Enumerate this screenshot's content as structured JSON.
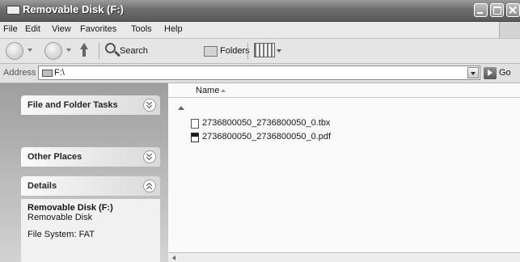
{
  "window": {
    "title": "Removable Disk (F:)"
  },
  "menu": {
    "items": [
      {
        "label": "File"
      },
      {
        "label": "Edit"
      },
      {
        "label": "View"
      },
      {
        "label": "Favorites"
      },
      {
        "label": "Tools"
      },
      {
        "label": "Help"
      }
    ]
  },
  "toolbar": {
    "search_label": "Search",
    "folders_label": "Folders"
  },
  "address": {
    "label": "Address",
    "value": "F:\\",
    "go_label": "Go"
  },
  "taskpane": {
    "file_tasks_label": "File and Folder Tasks",
    "other_places_label": "Other Places",
    "details_label": "Details",
    "details": {
      "name": "Removable Disk (F:)",
      "type": "Removable Disk",
      "file_system": "File System: FAT"
    }
  },
  "list": {
    "column_name": "Name",
    "files": [
      {
        "name": "2736800050_2736800050_0.tbx",
        "icon": "tbx-file-icon"
      },
      {
        "name": "2736800050_2736800050_0.pdf",
        "icon": "pdf-file-icon"
      }
    ]
  }
}
